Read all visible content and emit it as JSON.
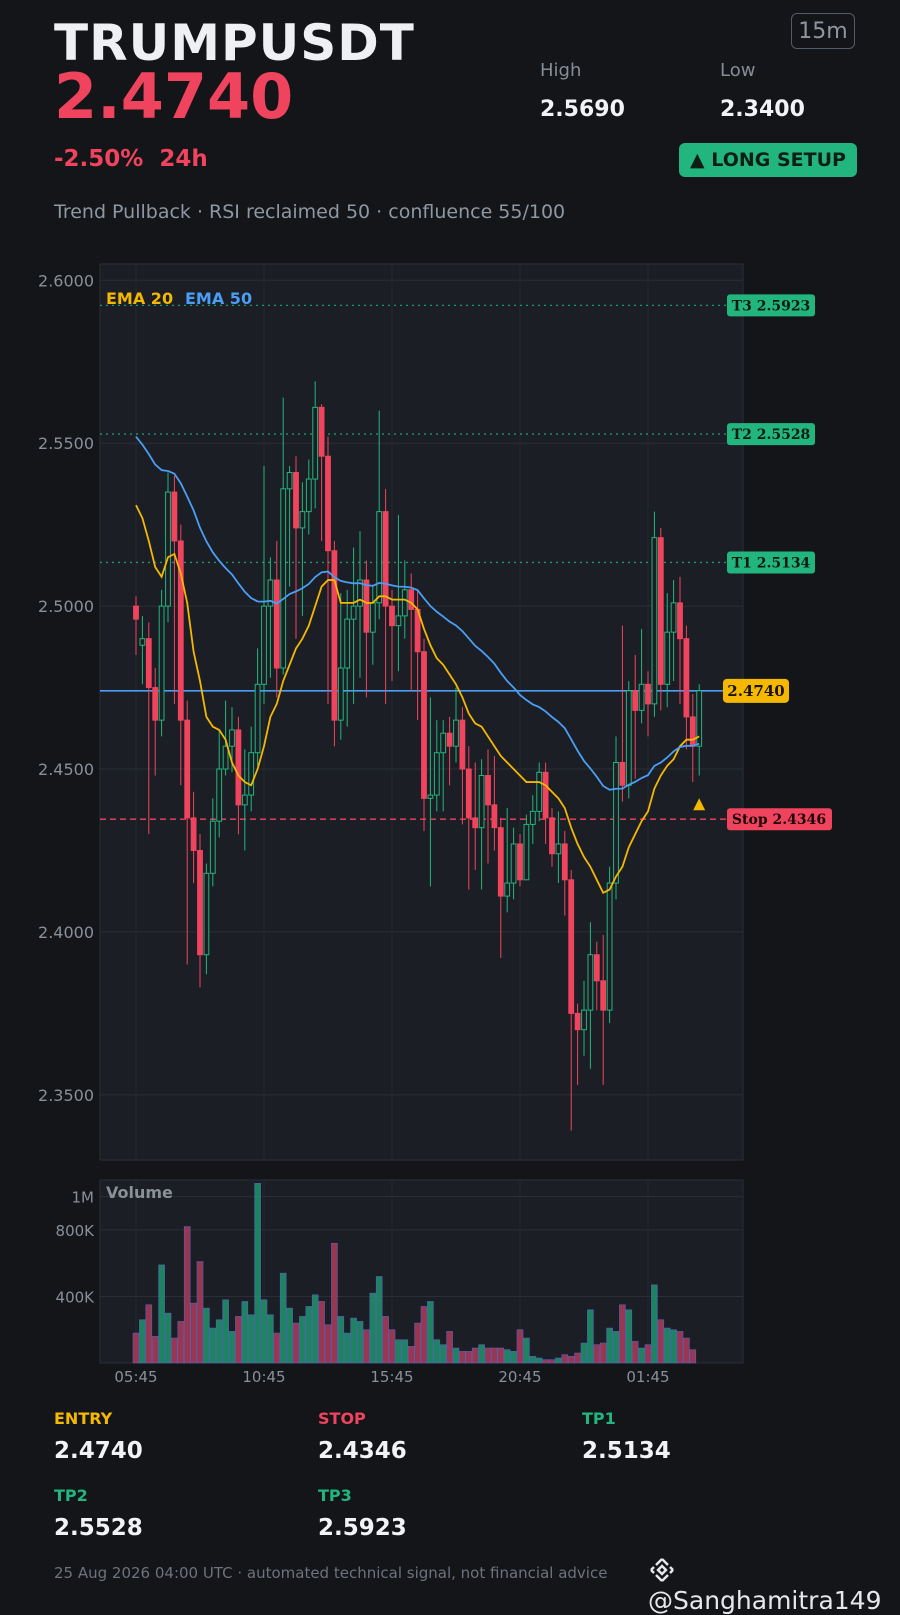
{
  "header": {
    "symbol": "TRUMPUSDT",
    "price": "2.4740",
    "timeframe": "15m",
    "high_label": "High",
    "high_value": "2.5690",
    "low_label": "Low",
    "low_value": "2.3400",
    "change": "-2.50%",
    "period": "24h",
    "setup_badge": "▲ LONG SETUP",
    "subtitle": "Trend Pullback · RSI reclaimed 50 · confluence 55/100"
  },
  "colors": {
    "background": "#131518",
    "panel": "#1b1e24",
    "up": "#22b67e",
    "down": "#f0445e",
    "ema20": "#f5b800",
    "ema50": "#4a9ef5",
    "entry": "#f5b800",
    "target": "#22b67e",
    "stop": "#f0445e"
  },
  "chart_data": {
    "type": "candlestick",
    "ylim": [
      2.33,
      2.605
    ],
    "y_ticks": [
      "2.6000",
      "2.5500",
      "2.5000",
      "2.4500",
      "2.4000",
      "2.3500"
    ],
    "y_tick_values": [
      2.6,
      2.55,
      2.5,
      2.45,
      2.4,
      2.35
    ],
    "x_ticks": [
      "05:45",
      "10:45",
      "15:45",
      "20:45",
      "01:45"
    ],
    "x_tick_index": [
      0,
      20,
      40,
      60,
      80
    ],
    "legend": [
      "EMA 20",
      "EMA 50"
    ],
    "legend_placement": "top-left",
    "grid": true,
    "candles": [
      [
        2.5,
        2.496,
        2.503,
        2.485
      ],
      [
        2.488,
        2.49,
        2.497,
        2.476
      ],
      [
        2.49,
        2.475,
        2.495,
        2.43
      ],
      [
        2.475,
        2.465,
        2.481,
        2.448
      ],
      [
        2.465,
        2.5,
        2.505,
        2.46
      ],
      [
        2.5,
        2.535,
        2.541,
        2.495
      ],
      [
        2.535,
        2.52,
        2.54,
        2.47
      ],
      [
        2.52,
        2.465,
        2.525,
        2.445
      ],
      [
        2.465,
        2.435,
        2.471,
        2.39
      ],
      [
        2.435,
        2.425,
        2.443,
        2.415
      ],
      [
        2.425,
        2.393,
        2.43,
        2.383
      ],
      [
        2.393,
        2.418,
        2.421,
        2.387
      ],
      [
        2.418,
        2.434,
        2.441,
        2.414
      ],
      [
        2.434,
        2.45,
        2.462,
        2.429
      ],
      [
        2.45,
        2.457,
        2.471,
        2.448
      ],
      [
        2.457,
        2.462,
        2.469,
        2.449
      ],
      [
        2.462,
        2.439,
        2.466,
        2.43
      ],
      [
        2.439,
        2.442,
        2.456,
        2.425
      ],
      [
        2.442,
        2.455,
        2.463,
        2.437
      ],
      [
        2.455,
        2.476,
        2.487,
        2.451
      ],
      [
        2.476,
        2.5,
        2.543,
        2.47
      ],
      [
        2.5,
        2.508,
        2.515,
        2.478
      ],
      [
        2.508,
        2.481,
        2.52,
        2.472
      ],
      [
        2.481,
        2.536,
        2.564,
        2.479
      ],
      [
        2.536,
        2.541,
        2.543,
        2.506
      ],
      [
        2.541,
        2.524,
        2.546,
        2.49
      ],
      [
        2.524,
        2.529,
        2.538,
        2.497
      ],
      [
        2.529,
        2.539,
        2.545,
        2.522
      ],
      [
        2.539,
        2.561,
        2.569,
        2.53
      ],
      [
        2.561,
        2.546,
        2.562,
        2.52
      ],
      [
        2.546,
        2.517,
        2.552,
        2.47
      ],
      [
        2.517,
        2.465,
        2.52,
        2.457
      ],
      [
        2.465,
        2.481,
        2.504,
        2.459
      ],
      [
        2.481,
        2.496,
        2.505,
        2.463
      ],
      [
        2.496,
        2.5,
        2.518,
        2.47
      ],
      [
        2.5,
        2.508,
        2.523,
        2.478
      ],
      [
        2.508,
        2.492,
        2.514,
        2.472
      ],
      [
        2.492,
        2.501,
        2.506,
        2.482
      ],
      [
        2.501,
        2.529,
        2.56,
        2.496
      ],
      [
        2.529,
        2.5,
        2.536,
        2.47
      ],
      [
        2.5,
        2.494,
        2.505,
        2.477
      ],
      [
        2.494,
        2.497,
        2.528,
        2.48
      ],
      [
        2.497,
        2.505,
        2.514,
        2.49
      ],
      [
        2.505,
        2.499,
        2.51,
        2.474
      ],
      [
        2.499,
        2.486,
        2.505,
        2.465
      ],
      [
        2.486,
        2.441,
        2.49,
        2.431
      ],
      [
        2.441,
        2.442,
        2.472,
        2.414
      ],
      [
        2.442,
        2.455,
        2.465,
        2.437
      ],
      [
        2.455,
        2.461,
        2.465,
        2.437
      ],
      [
        2.461,
        2.457,
        2.466,
        2.445
      ],
      [
        2.457,
        2.465,
        2.475,
        2.452
      ],
      [
        2.465,
        2.45,
        2.469,
        2.433
      ],
      [
        2.45,
        2.435,
        2.457,
        2.413
      ],
      [
        2.435,
        2.432,
        2.452,
        2.419
      ],
      [
        2.432,
        2.448,
        2.453,
        2.413
      ],
      [
        2.448,
        2.439,
        2.456,
        2.421
      ],
      [
        2.439,
        2.432,
        2.454,
        2.425
      ],
      [
        2.432,
        2.411,
        2.435,
        2.392
      ],
      [
        2.411,
        2.415,
        2.438,
        2.406
      ],
      [
        2.415,
        2.427,
        2.432,
        2.41
      ],
      [
        2.427,
        2.416,
        2.43,
        2.414
      ],
      [
        2.416,
        2.433,
        2.436,
        2.42
      ],
      [
        2.433,
        2.437,
        2.442,
        2.427
      ],
      [
        2.437,
        2.449,
        2.452,
        2.434
      ],
      [
        2.449,
        2.435,
        2.452,
        2.427
      ],
      [
        2.435,
        2.424,
        2.438,
        2.42
      ],
      [
        2.424,
        2.427,
        2.437,
        2.415
      ],
      [
        2.427,
        2.416,
        2.431,
        2.405
      ],
      [
        2.416,
        2.375,
        2.419,
        2.339
      ],
      [
        2.375,
        2.37,
        2.378,
        2.353
      ],
      [
        2.37,
        2.376,
        2.385,
        2.362
      ],
      [
        2.376,
        2.393,
        2.403,
        2.358
      ],
      [
        2.393,
        2.385,
        2.397,
        2.376
      ],
      [
        2.385,
        2.376,
        2.399,
        2.353
      ],
      [
        2.376,
        2.415,
        2.42,
        2.372
      ],
      [
        2.415,
        2.452,
        2.46,
        2.41
      ],
      [
        2.452,
        2.445,
        2.494,
        2.44
      ],
      [
        2.445,
        2.474,
        2.477,
        2.441
      ],
      [
        2.474,
        2.468,
        2.485,
        2.447
      ],
      [
        2.468,
        2.476,
        2.493,
        2.464
      ],
      [
        2.476,
        2.47,
        2.48,
        2.46
      ],
      [
        2.47,
        2.521,
        2.529,
        2.466
      ],
      [
        2.521,
        2.476,
        2.524,
        2.468
      ],
      [
        2.476,
        2.492,
        2.504,
        2.469
      ],
      [
        2.492,
        2.501,
        2.508,
        2.477
      ],
      [
        2.501,
        2.49,
        2.509,
        2.47
      ],
      [
        2.49,
        2.466,
        2.494,
        2.456
      ],
      [
        2.466,
        2.457,
        2.473,
        2.446
      ],
      [
        2.457,
        2.474,
        2.476,
        2.448
      ]
    ],
    "ema20": [
      2.531,
      2.527,
      2.52,
      2.512,
      2.509,
      2.515,
      2.516,
      2.51,
      2.501,
      2.486,
      2.477,
      2.466,
      2.463,
      2.462,
      2.459,
      2.452,
      2.448,
      2.446,
      2.445,
      2.45,
      2.457,
      2.466,
      2.47,
      2.477,
      2.482,
      2.487,
      2.49,
      2.494,
      2.5,
      2.506,
      2.508,
      2.508,
      2.501,
      2.501,
      2.501,
      2.502,
      2.501,
      2.501,
      2.503,
      2.503,
      2.502,
      2.502,
      2.502,
      2.501,
      2.499,
      2.493,
      2.488,
      2.484,
      2.482,
      2.479,
      2.476,
      2.472,
      2.467,
      2.464,
      2.463,
      2.46,
      2.457,
      2.454,
      2.452,
      2.45,
      2.448,
      2.446,
      2.446,
      2.446,
      2.445,
      2.443,
      2.441,
      2.438,
      2.432,
      2.427,
      2.423,
      2.42,
      2.416,
      2.412,
      2.413,
      2.417,
      2.42,
      2.426,
      2.43,
      2.434,
      2.437,
      2.444,
      2.448,
      2.451,
      2.453,
      2.457,
      2.459,
      2.459,
      2.46
    ]
  },
  "volume_data": {
    "label": "Volume",
    "y_ticks": [
      "1M",
      "800K",
      "400K"
    ],
    "y_tick_values": [
      1000000,
      800000,
      400000
    ],
    "values": [
      180000,
      260000,
      350000,
      160000,
      590000,
      300000,
      150000,
      250000,
      820000,
      360000,
      610000,
      330000,
      210000,
      260000,
      380000,
      190000,
      280000,
      370000,
      290000,
      1080000,
      380000,
      290000,
      180000,
      540000,
      330000,
      240000,
      280000,
      340000,
      410000,
      370000,
      230000,
      720000,
      280000,
      180000,
      270000,
      250000,
      200000,
      420000,
      520000,
      280000,
      200000,
      140000,
      140000,
      100000,
      240000,
      340000,
      370000,
      140000,
      110000,
      190000,
      90000,
      70000,
      70000,
      90000,
      110000,
      90000,
      90000,
      90000,
      80000,
      70000,
      200000,
      150000,
      40000,
      30000,
      20000,
      20000,
      30000,
      50000,
      40000,
      60000,
      120000,
      320000,
      110000,
      120000,
      210000,
      190000,
      350000,
      320000,
      130000,
      90000,
      110000,
      470000,
      260000,
      210000,
      200000,
      190000,
      150000,
      80000
    ]
  },
  "levels": {
    "t3_label": "T3 2.5923",
    "t2_label": "T2 2.5528",
    "t1_label": "T1 2.5134",
    "price_label": "2.4740",
    "stop_label": "Stop 2.4346",
    "t3": 2.5923,
    "t2": 2.5528,
    "t1": 2.5134,
    "entry": 2.474,
    "stop": 2.4346
  },
  "cards": {
    "entry_label": "ENTRY",
    "entry_value": "2.4740",
    "stop_label": "STOP",
    "stop_value": "2.4346",
    "tp1_label": "TP1",
    "tp1_value": "2.5134",
    "tp2_label": "TP2",
    "tp2_value": "2.5528",
    "tp3_label": "TP3",
    "tp3_value": "2.5923"
  },
  "footer": {
    "text": "25 Aug 2026 04:00 UTC  ·  automated technical signal, not financial advice",
    "brand": "@Sanghamitra149",
    "brand_icon": "binance-logo-icon"
  }
}
